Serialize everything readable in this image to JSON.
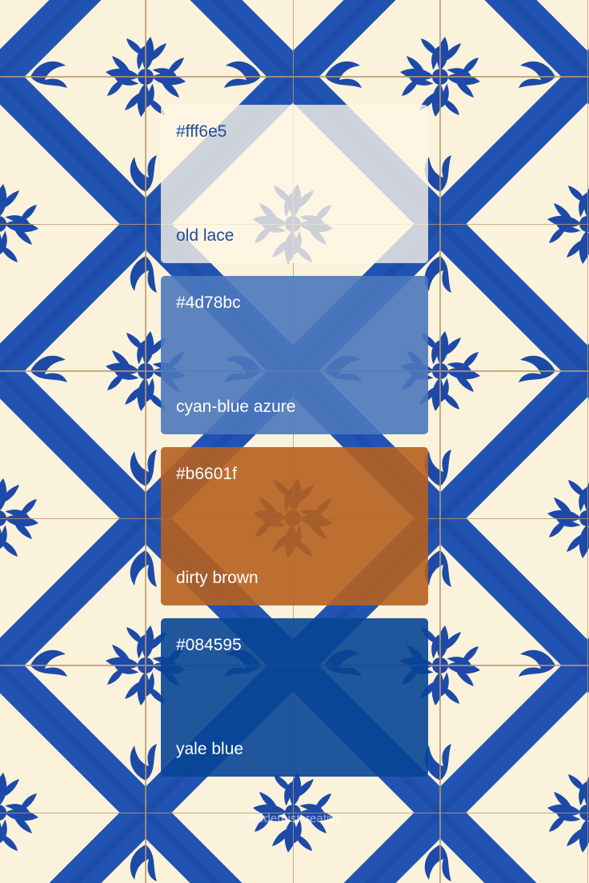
{
  "swatches": [
    {
      "hex": "#fff6e5",
      "name": "old lace"
    },
    {
      "hex": "#4d78bc",
      "name": "cyan-blue azure"
    },
    {
      "hex": "#b6601f",
      "name": "dirty brown"
    },
    {
      "hex": "#084595",
      "name": "yale blue"
    }
  ],
  "watermark": "modernistcreative",
  "colors": {
    "tile_blue": "#1d4aa8",
    "tile_cream": "#fbf2dc",
    "grout": "#b89a6a"
  },
  "background_description_icon": "azulejo-tile-pattern"
}
